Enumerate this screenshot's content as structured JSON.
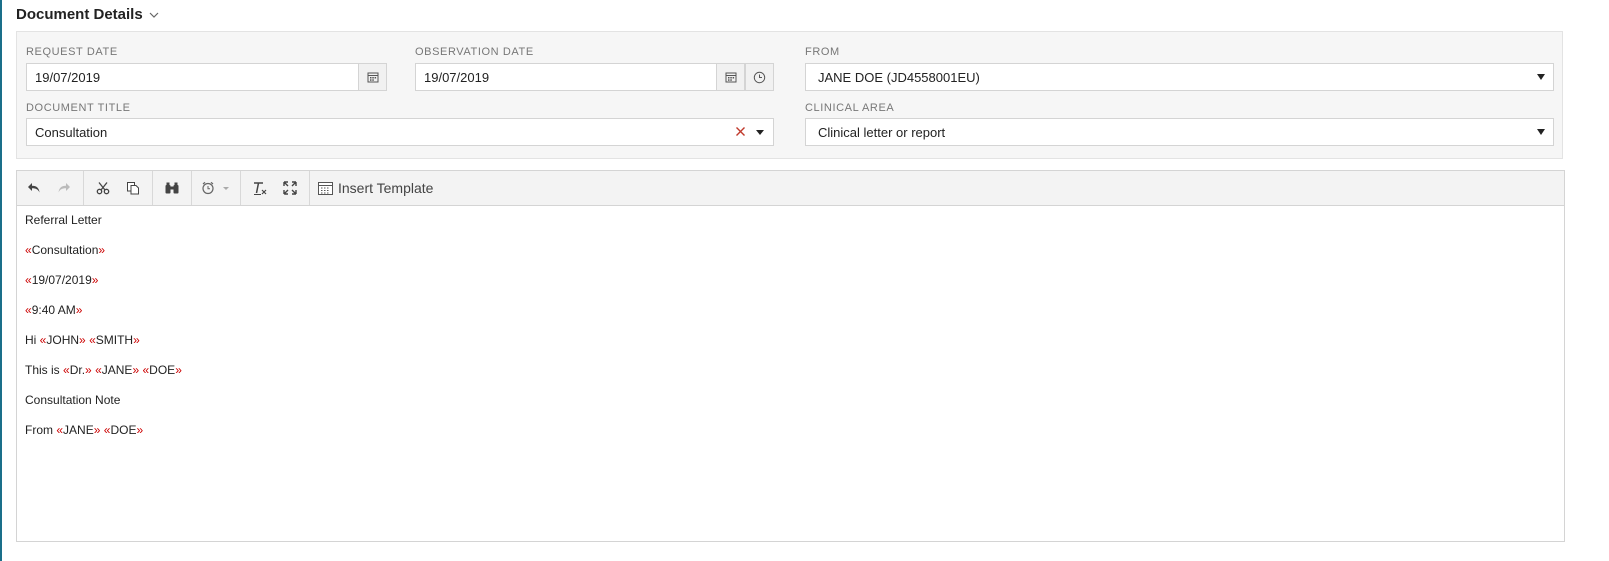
{
  "header": {
    "title": "Document Details"
  },
  "form": {
    "request_date": {
      "label": "REQUEST DATE",
      "value": "19/07/2019"
    },
    "observation_date": {
      "label": "OBSERVATION DATE",
      "value": "19/07/2019"
    },
    "from": {
      "label": "FROM",
      "value": "JANE DOE (JD4558001EU)"
    },
    "document_title": {
      "label": "DOCUMENT TITLE",
      "value": "Consultation"
    },
    "clinical_area": {
      "label": "CLINICAL AREA",
      "value": "Clinical letter or report"
    }
  },
  "toolbar": {
    "insert_template_label": "Insert Template"
  },
  "editor": {
    "line1": "Referral Letter",
    "line2_field": "Consultation",
    "line3_field": "19/07/2019",
    "line4_field": "9:40 AM",
    "line5": {
      "prefix": "Hi ",
      "field1": "JOHN",
      "field2": "SMITH"
    },
    "line6": {
      "prefix": "This is ",
      "field1": "Dr.",
      "field2": "JANE",
      "field3": "DOE"
    },
    "line7": "Consultation Note",
    "line8": {
      "prefix": "From ",
      "field1": "JANE",
      "field2": "DOE"
    }
  },
  "markers": {
    "open": "«",
    "close": "»"
  },
  "colors": {
    "merge_field_marker": "#cc0000",
    "clear_icon": "#c0392b",
    "accent_edge": "#1a6f8a"
  },
  "icons": [
    "chevron-down-icon",
    "calendar-icon",
    "clock-icon",
    "clear-icon",
    "undo-icon",
    "redo-icon",
    "cut-icon",
    "copy-icon",
    "find-icon",
    "alarm-icon",
    "clear-formatting-icon",
    "fullscreen-icon",
    "template-icon"
  ]
}
